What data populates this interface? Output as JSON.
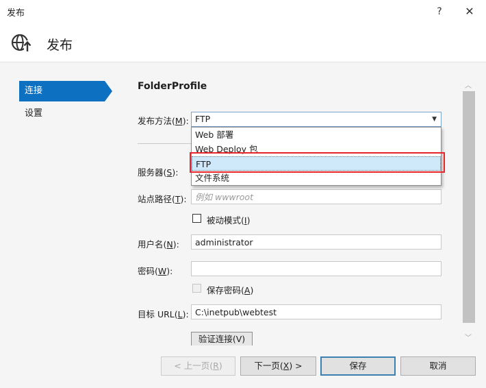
{
  "window": {
    "title": "发布",
    "help_label": "?",
    "close_label": "✕"
  },
  "header": {
    "title": "发布",
    "icon": "globe-publish-icon"
  },
  "nav": {
    "items": [
      {
        "label": "连接",
        "active": true
      },
      {
        "label": "设置",
        "active": false
      }
    ]
  },
  "profile": {
    "name": "FolderProfile"
  },
  "form": {
    "publish_method": {
      "label": "发布方法(",
      "mnemonic": "M",
      "label_end": "):",
      "value": "FTP"
    },
    "server": {
      "label": "服务器(",
      "mnemonic": "S",
      "label_end": "):"
    },
    "site_path": {
      "label": "站点路径(",
      "mnemonic": "T",
      "label_end": "):",
      "placeholder": "例如 wwwroot"
    },
    "passive_mode": {
      "label": "被动模式(",
      "mnemonic": "I",
      "label_end": ")",
      "checked": false
    },
    "username": {
      "label": "用户名(",
      "mnemonic": "N",
      "label_end": "):",
      "value": "administrator"
    },
    "password": {
      "label": "密码(",
      "mnemonic": "W",
      "label_end": "):",
      "value": ""
    },
    "save_password": {
      "label": "保存密码(",
      "mnemonic": "A",
      "label_end": ")",
      "checked": false,
      "disabled": true
    },
    "target_url": {
      "label": "目标 URL(",
      "mnemonic": "L",
      "label_end": "):",
      "value": "C:\\inetpub\\webtest"
    },
    "verify_button": "验证连接(V)"
  },
  "dropdown": {
    "options": [
      "Web 部署",
      "Web Deploy 包",
      "FTP",
      "文件系统"
    ],
    "selected_index": 2
  },
  "footer": {
    "prev": {
      "label": "< 上一页(",
      "mnemonic": "R",
      "label_end": ")"
    },
    "next": {
      "label": "下一页(",
      "mnemonic": "X",
      "label_end": ") >"
    },
    "save": "保存",
    "cancel": "取消"
  },
  "colors": {
    "accent": "#0e70c0",
    "highlight_frame": "#e8242b",
    "selected_option": "#cfe8fa"
  }
}
